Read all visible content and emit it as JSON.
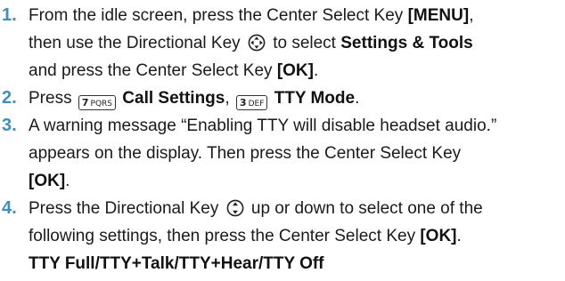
{
  "steps": [
    {
      "number": "1.",
      "t1": "From the idle screen, press the Center Select Key ",
      "b1": "[MENU]",
      "t2": ",",
      "t3": "then use the Directional Key ",
      "icon": "directional-pad-icon",
      "t4": " to select ",
      "b2": "Settings & Tools",
      "t5": "and press the Center Select Key ",
      "b3": "[OK]",
      "t6": "."
    },
    {
      "number": "2.",
      "t1": "Press ",
      "key1_digit": "7",
      "key1_letters": "PQRS",
      "b1": "Call Settings",
      "t2": ", ",
      "key2_digit": "3",
      "key2_letters": "DEF",
      "b2": "TTY Mode",
      "t3": "."
    },
    {
      "number": "3.",
      "t1": "A warning message “Enabling TTY will disable headset audio.”",
      "t2": "appears on the display. Then press the Center Select Key",
      "b1": "[OK]",
      "t3": "."
    },
    {
      "number": "4.",
      "t1": "Press the Directional Key ",
      "icon": "up-down-key-icon",
      "t2": " up or down to select one of the",
      "t3": "following settings, then press the Center Select Key ",
      "b1": "[OK]",
      "t4": ".",
      "b2": "TTY Full/TTY+Talk/TTY+Hear/TTY Off"
    }
  ]
}
